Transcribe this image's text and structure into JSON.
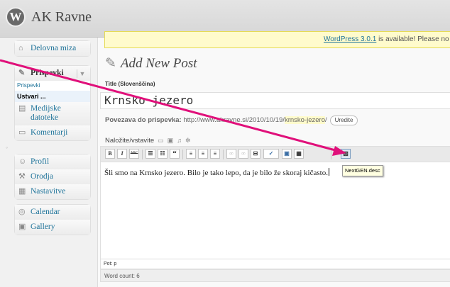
{
  "header": {
    "logo_glyph": "W",
    "site_title": "AK Ravne"
  },
  "nag": {
    "link": "WordPress 3.0.1",
    "text": " is available! Please no"
  },
  "sidebar": {
    "dashboard": "Delovna miza",
    "posts": "Prispevki",
    "posts_sub": "Prispevki",
    "posts_new": "Ustvari ...",
    "media_line1": "Medijske",
    "media_line2": "datoteke",
    "comments": "Komentarji",
    "profile": "Profil",
    "tools": "Orodja",
    "settings": "Nastavitve",
    "calendar": "Calendar",
    "gallery": "Gallery",
    "toggle": "▼"
  },
  "main": {
    "page_title": "Add New Post",
    "title_label": "Title (Slovenščina)",
    "title_value": "Krnsko jezero",
    "permalink_label": "Povezava do prispevka:",
    "permalink_base": "http://www.akravne.si/2010/10/19/",
    "permalink_slug": "krnsko-jezero",
    "permalink_end": "/",
    "edit_button": "Uredite",
    "upload_label": "Naložite/vstavite",
    "editor_text": "Šli smo na Krnsko jezero. Bilo je tako lepo, da je bilo že skoraj kičasto.",
    "tooltip": "NextGEN.desc",
    "path": "Pot: p",
    "word_count": "Word count: 6"
  },
  "toolbar": {
    "bold": "B",
    "italic": "I",
    "strike": "ABC",
    "bullist": "☰",
    "numlist": "☷",
    "quote": "“",
    "alignleft": "≡",
    "aligncenter": "≡",
    "alignright": "≡",
    "link": "∞",
    "unlink": "∞",
    "more": "⊟",
    "spell": "✓",
    "fullscreen": "▣",
    "kitchen": "▦",
    "nextgen": "▨"
  },
  "colors": {
    "link": "#21759b",
    "annotation_arrow": "#e0107a",
    "nag_bg": "#fffbcc"
  },
  "icons": [
    "wordpress-logo-icon",
    "home-icon",
    "pin-icon",
    "media-icon",
    "comment-icon",
    "user-icon",
    "tools-icon",
    "settings-icon",
    "calendar-icon",
    "gallery-icon"
  ]
}
